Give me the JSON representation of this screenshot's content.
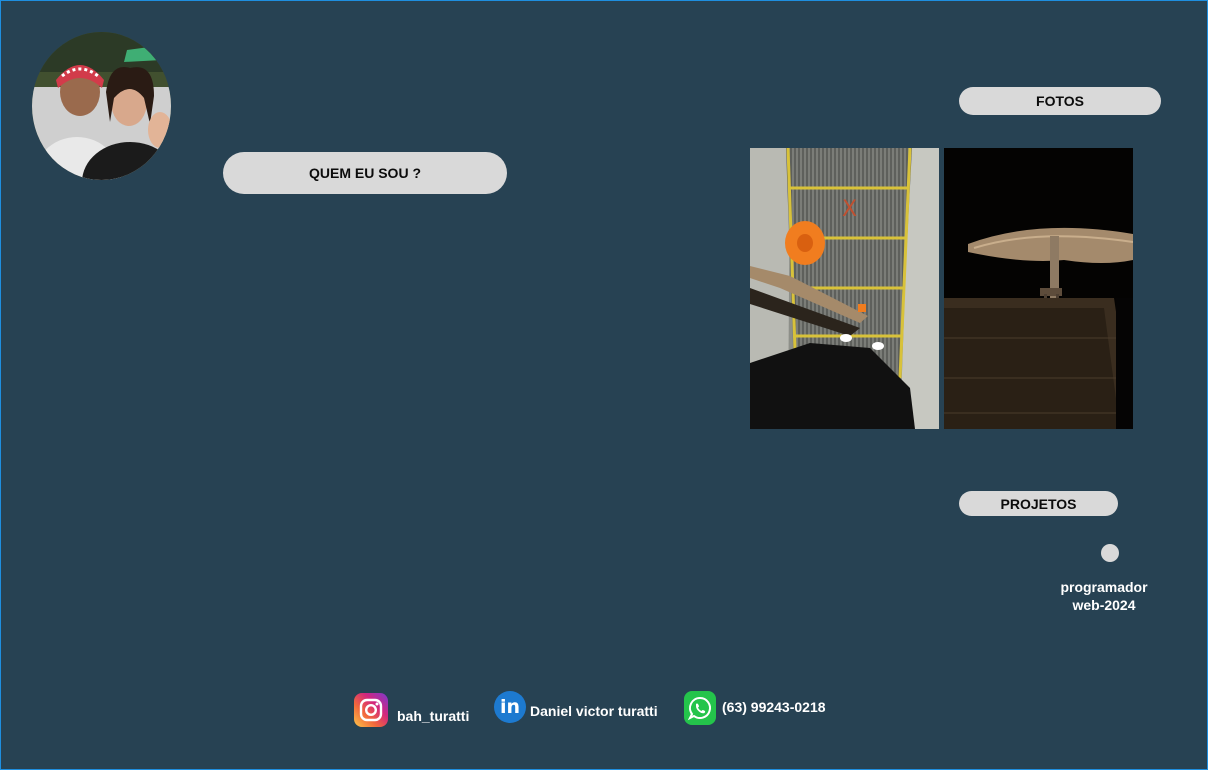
{
  "profile": {
    "avatar_icon": "profile-photo"
  },
  "nav": {
    "quem_eu_sou": "QUEM EU SOU ?",
    "fotos": "FOTOS",
    "projetos": "PROJETOS"
  },
  "photos": [
    {
      "icon": "skateboard-escalator-photo"
    },
    {
      "icon": "night-pier-photo"
    }
  ],
  "project": {
    "line1": "programador",
    "line2": "web-2024"
  },
  "social": {
    "instagram": {
      "icon": "instagram-icon",
      "label": "bah_turatti"
    },
    "linkedin": {
      "icon": "linkedin-icon",
      "label": "Daniel victor turatti"
    },
    "whatsapp": {
      "icon": "whatsapp-icon",
      "label": "(63) 99243-0218"
    }
  },
  "colors": {
    "background": "#274253",
    "pill": "#d9d9d9",
    "frame_border": "#1e8fe0"
  }
}
